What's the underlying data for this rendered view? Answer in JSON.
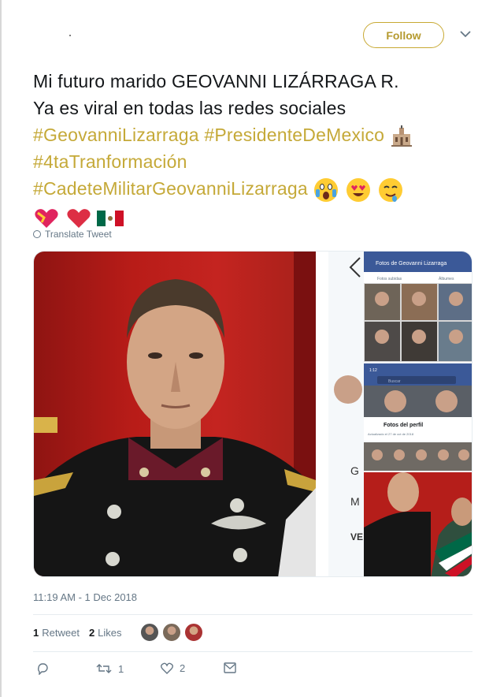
{
  "header": {
    "follow_label": "Follow"
  },
  "tweet": {
    "line1": "Mi futuro marido GEOVANNI LIZÁRRAGA R.",
    "line2": "Ya es viral en todas las redes sociales",
    "tag1": "#GeovanniLizarraga",
    "tag2": "#PresidenteDeMexico",
    "tag3": "#4taTranformación",
    "tag4": "#CadeteMilitarGeovanniLizarraga"
  },
  "translate_label": "Translate Tweet",
  "timestamp": "11:19 AM - 1 Dec 2018",
  "stats": {
    "retweets_count": "1",
    "retweets_label": "Retweet",
    "likes_count": "2",
    "likes_label": "Likes"
  },
  "actions": {
    "retweet_count": "1",
    "like_count": "2"
  },
  "screenshot": {
    "title": "Fotos de Geovanni Lizarraga",
    "tab1": "Fotos subidas",
    "tab2": "Álbumes",
    "time": "1:12",
    "search_placeholder": "Buscar",
    "profile_photos": "Fotos del perfil",
    "updated": "Actualizado el 27 de oct de 2018",
    "side1": "G",
    "side2": "M",
    "side3": "VE"
  },
  "colors": {
    "accent": "#c5a938",
    "muted": "#657786",
    "text": "#14171a"
  }
}
